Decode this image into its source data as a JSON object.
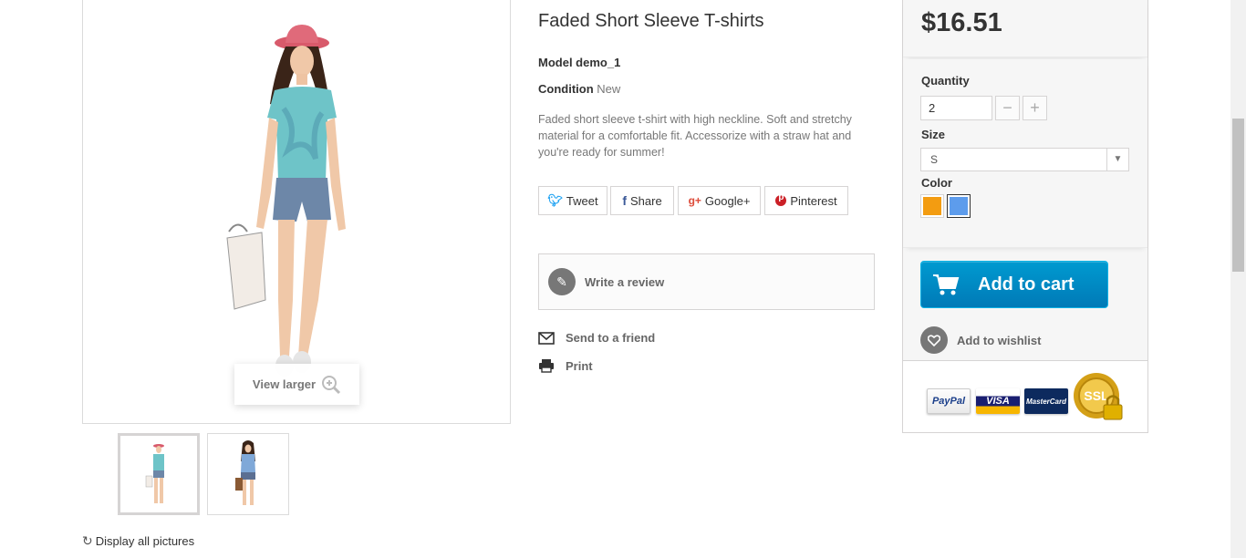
{
  "gallery": {
    "view_larger_label": "View larger",
    "display_all_label": "Display all pictures",
    "thumbnails": [
      "Faded short sleeve t-shirt front",
      "Faded short sleeve t-shirt blue"
    ]
  },
  "product": {
    "title": "Faded Short Sleeve T-shirts",
    "model": "Model demo_1",
    "condition_label": "Condition",
    "condition_value": "New",
    "description": "Faded short sleeve t-shirt with high neckline. Soft and stretchy material for a comfortable fit. Accessorize with a straw hat and you're ready for summer!"
  },
  "social": {
    "tweet": "Tweet",
    "share": "Share",
    "google": "Google+",
    "pinterest": "Pinterest"
  },
  "actions": {
    "write_review": "Write a review",
    "send_friend": "Send to a friend",
    "print": "Print"
  },
  "buy": {
    "price": "$16.51",
    "quantity_label": "Quantity",
    "quantity_value": "2",
    "size_label": "Size",
    "size_value": "S",
    "color_label": "Color",
    "colors": [
      "#f39c11",
      "#5d9cec"
    ],
    "add_to_cart": "Add to cart",
    "add_to_wishlist": "Add to wishlist"
  },
  "payment": {
    "paypal": "PayPal",
    "visa": "VISA",
    "mastercard": "MasterCard",
    "ssl": "SSL"
  },
  "icons": {
    "zoom": "zoom-in-icon",
    "refresh": "refresh-icon",
    "twitter": "twitter-icon",
    "facebook": "facebook-icon",
    "google": "google-plus-icon",
    "pinterest": "pinterest-icon",
    "pencil": "pencil-icon",
    "envelope": "envelope-icon",
    "printer": "printer-icon",
    "cart": "cart-icon",
    "heart": "heart-icon"
  }
}
